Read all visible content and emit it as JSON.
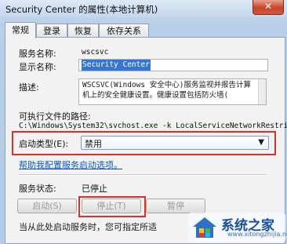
{
  "window": {
    "title": "Security Center 的属性(本地计算机)",
    "close_glyph": "✕"
  },
  "tabs": [
    {
      "label": "常规",
      "active": true
    },
    {
      "label": "登录",
      "active": false
    },
    {
      "label": "恢复",
      "active": false
    },
    {
      "label": "依存关系",
      "active": false
    }
  ],
  "general": {
    "service_name_label": "服务名称:",
    "service_name_value": "wscsvc",
    "display_name_label": "显示名称:",
    "display_name_value": "Security Center",
    "description_label": "描述:",
    "description_value": "WSCSVC(Windows 安全中心)服务监视并报告计算机上的安全健康设置。健康设置包括防火墙(",
    "exec_path_label": "可执行文件的路径:",
    "exec_path_value": "C:\\Windows\\System32\\svchost.exe -k LocalServiceNetworkRestri",
    "startup_type_label": "启动类型(E):",
    "startup_type_value": "禁用",
    "help_link": "帮助我配置服务启动选项。",
    "status_label": "服务状态:",
    "status_value": "已停止",
    "buttons": {
      "start": "启动(S)",
      "stop": "停止(T)",
      "pause": "暂停"
    },
    "bottom_note": "当从此处启动服务时，您可指定所适"
  },
  "watermark": {
    "text": "系统之家",
    "url": "www.xitongzhijia.net"
  },
  "colors": {
    "highlight_frame": "#d9302b",
    "link": "#0a55c4",
    "selection": "#3476d2"
  }
}
